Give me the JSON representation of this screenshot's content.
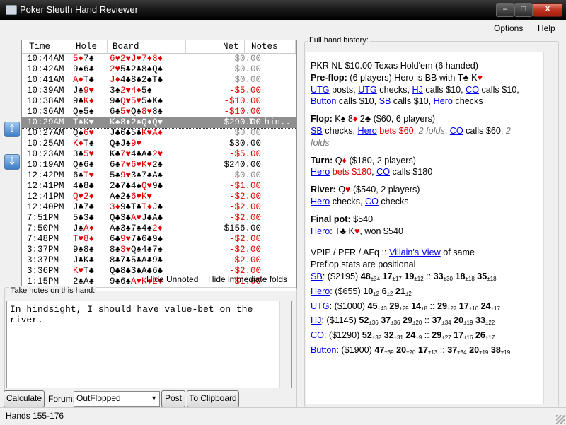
{
  "window": {
    "title": "Poker Sleuth Hand Reviewer",
    "minimize_label": "–",
    "maximize_label": "□",
    "close_label": "X"
  },
  "menu": {
    "options": "Options",
    "help": "Help"
  },
  "hand_list": {
    "columns": {
      "time": "Time",
      "hole": "Hole",
      "board": "Board",
      "net": "Net",
      "notes": "Notes"
    },
    "rows": [
      {
        "time": "10:44AM",
        "hole": [
          [
            "5♦",
            "red"
          ],
          [
            "7♣",
            "black"
          ]
        ],
        "board": [
          [
            "6♥",
            "red"
          ],
          [
            "2♥",
            "red"
          ],
          [
            "J♥",
            "red"
          ],
          [
            "7♦",
            "red"
          ],
          [
            "8♦",
            "red"
          ]
        ],
        "net": "$0.00",
        "net_type": "zero",
        "notes": ""
      },
      {
        "time": "10:42AM",
        "hole": [
          [
            "9♠",
            "black"
          ],
          [
            "6♣",
            "black"
          ]
        ],
        "board": [
          [
            "2♥",
            "red"
          ],
          [
            "5♣",
            "black"
          ],
          [
            "2♣",
            "black"
          ],
          [
            "8♠",
            "black"
          ],
          [
            "Q♠",
            "black"
          ]
        ],
        "net": "$0.00",
        "net_type": "zero",
        "notes": ""
      },
      {
        "time": "10:41AM",
        "hole": [
          [
            "A♦",
            "red"
          ],
          [
            "T♣",
            "black"
          ]
        ],
        "board": [
          [
            "J♦",
            "red"
          ],
          [
            "4♣",
            "black"
          ],
          [
            "8♣",
            "black"
          ],
          [
            "2♠",
            "black"
          ],
          [
            "T♣",
            "black"
          ]
        ],
        "net": "$0.00",
        "net_type": "zero",
        "notes": ""
      },
      {
        "time": "10:39AM",
        "hole": [
          [
            "J♣",
            "black"
          ],
          [
            "9♥",
            "red"
          ]
        ],
        "board": [
          [
            "3♠",
            "black"
          ],
          [
            "2♥",
            "red"
          ],
          [
            "4♦",
            "red"
          ],
          [
            "5♠",
            "black"
          ]
        ],
        "net": "-$5.00",
        "net_type": "neg",
        "notes": ""
      },
      {
        "time": "10:38AM",
        "hole": [
          [
            "9♣",
            "black"
          ],
          [
            "K♦",
            "red"
          ]
        ],
        "board": [
          [
            "9♣",
            "black"
          ],
          [
            "Q♥",
            "red"
          ],
          [
            "5♥",
            "red"
          ],
          [
            "5♠",
            "black"
          ],
          [
            "K♠",
            "black"
          ]
        ],
        "net": "-$10.00",
        "net_type": "neg",
        "notes": ""
      },
      {
        "time": "10:36AM",
        "hole": [
          [
            "Q♠",
            "black"
          ],
          [
            "5♠",
            "black"
          ]
        ],
        "board": [
          [
            "6♣",
            "black"
          ],
          [
            "5♥",
            "red"
          ],
          [
            "Q♣",
            "black"
          ],
          [
            "8♥",
            "red"
          ],
          [
            "8♣",
            "black"
          ]
        ],
        "net": "-$10.00",
        "net_type": "neg",
        "notes": ""
      },
      {
        "time": "10:29AM",
        "hole": [
          [
            "T♣",
            "black"
          ],
          [
            "K♥",
            "red"
          ]
        ],
        "board": [
          [
            "K♠",
            "black"
          ],
          [
            "8♦",
            "red"
          ],
          [
            "2♣",
            "black"
          ],
          [
            "Q♦",
            "red"
          ],
          [
            "Q♥",
            "red"
          ]
        ],
        "net": "$290.00",
        "net_type": "pos",
        "notes": "In hin..",
        "selected": true
      },
      {
        "time": "10:27AM",
        "hole": [
          [
            "Q♠",
            "black"
          ],
          [
            "6♥",
            "red"
          ]
        ],
        "board": [
          [
            "J♣",
            "black"
          ],
          [
            "6♣",
            "black"
          ],
          [
            "5♣",
            "black"
          ],
          [
            "K♥",
            "red"
          ],
          [
            "A♦",
            "red"
          ]
        ],
        "net": "$0.00",
        "net_type": "zero",
        "notes": ""
      },
      {
        "time": "10:25AM",
        "hole": [
          [
            "K♦",
            "red"
          ],
          [
            "T♣",
            "black"
          ]
        ],
        "board": [
          [
            "Q♣",
            "black"
          ],
          [
            "J♣",
            "black"
          ],
          [
            "9♥",
            "red"
          ]
        ],
        "net": "$30.00",
        "net_type": "pos",
        "notes": ""
      },
      {
        "time": "10:23AM",
        "hole": [
          [
            "3♣",
            "black"
          ],
          [
            "5♥",
            "red"
          ]
        ],
        "board": [
          [
            "K♣",
            "black"
          ],
          [
            "7♥",
            "red"
          ],
          [
            "4♣",
            "black"
          ],
          [
            "A♣",
            "black"
          ],
          [
            "2♥",
            "red"
          ]
        ],
        "net": "-$5.00",
        "net_type": "neg",
        "notes": ""
      },
      {
        "time": "10:19AM",
        "hole": [
          [
            "Q♣",
            "black"
          ],
          [
            "6♣",
            "black"
          ]
        ],
        "board": [
          [
            "6♣",
            "black"
          ],
          [
            "7♥",
            "red"
          ],
          [
            "6♥",
            "red"
          ],
          [
            "K♥",
            "red"
          ],
          [
            "2♣",
            "black"
          ]
        ],
        "net": "$240.00",
        "net_type": "pos",
        "notes": ""
      },
      {
        "time": "12:42PM",
        "hole": [
          [
            "6♣",
            "black"
          ],
          [
            "T♥",
            "red"
          ]
        ],
        "board": [
          [
            "5♣",
            "black"
          ],
          [
            "9♥",
            "red"
          ],
          [
            "3♣",
            "black"
          ],
          [
            "7♣",
            "black"
          ],
          [
            "A♣",
            "black"
          ]
        ],
        "net": "$0.00",
        "net_type": "zero",
        "notes": ""
      },
      {
        "time": "12:41PM",
        "hole": [
          [
            "4♣",
            "black"
          ],
          [
            "8♣",
            "black"
          ]
        ],
        "board": [
          [
            "2♣",
            "black"
          ],
          [
            "7♣",
            "black"
          ],
          [
            "4♠",
            "black"
          ],
          [
            "Q♥",
            "red"
          ],
          [
            "9♣",
            "black"
          ]
        ],
        "net": "-$1.00",
        "net_type": "neg",
        "notes": ""
      },
      {
        "time": "12:41PM",
        "hole": [
          [
            "Q♥",
            "red"
          ],
          [
            "2♦",
            "red"
          ]
        ],
        "board": [
          [
            "A♠",
            "black"
          ],
          [
            "2♣",
            "black"
          ],
          [
            "6♥",
            "red"
          ],
          [
            "K♥",
            "red"
          ]
        ],
        "net": "-$2.00",
        "net_type": "neg",
        "notes": ""
      },
      {
        "time": "12:40PM",
        "hole": [
          [
            "J♣",
            "black"
          ],
          [
            "7♣",
            "black"
          ]
        ],
        "board": [
          [
            "3♦",
            "red"
          ],
          [
            "9♣",
            "black"
          ],
          [
            "T♣",
            "black"
          ],
          [
            "T♦",
            "red"
          ],
          [
            "J♣",
            "black"
          ]
        ],
        "net": "-$2.00",
        "net_type": "neg",
        "notes": ""
      },
      {
        "time": "7:51PM",
        "hole": [
          [
            "5♣",
            "black"
          ],
          [
            "3♣",
            "black"
          ]
        ],
        "board": [
          [
            "Q♣",
            "black"
          ],
          [
            "3♣",
            "black"
          ],
          [
            "A♥",
            "red"
          ],
          [
            "J♣",
            "black"
          ],
          [
            "A♣",
            "black"
          ]
        ],
        "net": "-$2.00",
        "net_type": "neg",
        "notes": ""
      },
      {
        "time": "7:50PM",
        "hole": [
          [
            "J♣",
            "black"
          ],
          [
            "A♦",
            "red"
          ]
        ],
        "board": [
          [
            "A♣",
            "black"
          ],
          [
            "3♣",
            "black"
          ],
          [
            "7♣",
            "black"
          ],
          [
            "4♠",
            "black"
          ],
          [
            "2♦",
            "red"
          ]
        ],
        "net": "$156.00",
        "net_type": "pos",
        "notes": ""
      },
      {
        "time": "7:48PM",
        "hole": [
          [
            "T♥",
            "red"
          ],
          [
            "8♦",
            "red"
          ]
        ],
        "board": [
          [
            "6♣",
            "black"
          ],
          [
            "9♥",
            "red"
          ],
          [
            "7♣",
            "black"
          ],
          [
            "6♣",
            "black"
          ],
          [
            "9♠",
            "black"
          ]
        ],
        "net": "-$2.00",
        "net_type": "neg",
        "notes": ""
      },
      {
        "time": "3:37PM",
        "hole": [
          [
            "9♣",
            "black"
          ],
          [
            "8♣",
            "black"
          ]
        ],
        "board": [
          [
            "8♣",
            "black"
          ],
          [
            "3♥",
            "red"
          ],
          [
            "Q♣",
            "black"
          ],
          [
            "4♣",
            "black"
          ],
          [
            "7♠",
            "black"
          ]
        ],
        "net": "-$2.00",
        "net_type": "neg",
        "notes": ""
      },
      {
        "time": "3:37PM",
        "hole": [
          [
            "J♣",
            "black"
          ],
          [
            "K♣",
            "black"
          ]
        ],
        "board": [
          [
            "8♣",
            "black"
          ],
          [
            "7♣",
            "black"
          ],
          [
            "5♣",
            "black"
          ],
          [
            "A♣",
            "black"
          ],
          [
            "9♣",
            "black"
          ]
        ],
        "net": "-$2.00",
        "net_type": "neg",
        "notes": ""
      },
      {
        "time": "3:36PM",
        "hole": [
          [
            "K♥",
            "red"
          ],
          [
            "T♣",
            "black"
          ]
        ],
        "board": [
          [
            "Q♣",
            "black"
          ],
          [
            "8♣",
            "black"
          ],
          [
            "3♣",
            "black"
          ],
          [
            "A♣",
            "black"
          ],
          [
            "6♣",
            "black"
          ]
        ],
        "net": "-$2.00",
        "net_type": "neg",
        "notes": ""
      },
      {
        "time": "1:15PM",
        "hole": [
          [
            "2♣",
            "black"
          ],
          [
            "A♣",
            "black"
          ]
        ],
        "board": [
          [
            "9♣",
            "black"
          ],
          [
            "6♣",
            "black"
          ],
          [
            "A♥",
            "red"
          ],
          [
            "K♦",
            "red"
          ],
          [
            "2♥",
            "red"
          ]
        ],
        "net": "-$1.00",
        "net_type": "neg",
        "notes": ""
      }
    ]
  },
  "filters": {
    "hide_unnoted": "Hide Unnoted",
    "hide_immediate_folds": "Hide immediate folds"
  },
  "notes": {
    "label": "Take notes on this hand:",
    "text": "In hindsight, I should have value-bet on the\nriver."
  },
  "actions": {
    "calculate": "Calculate",
    "forum_label": "Forum:",
    "forum_value": "OutFlopped",
    "post": "Post",
    "to_clipboard": "To Clipboard"
  },
  "history": {
    "label": "Full hand history:",
    "game": "PKR NL $10.00 Texas Hold'em (6 handed)",
    "preflop_hdr": "Pre-flop:",
    "preflop_desc": " (6 players) Hero is BB with T♣ K",
    "preflop_heart": "♥",
    "utg": "UTG",
    "posts": " posts, ",
    "checks": " checks, ",
    "hj": "HJ",
    "calls10": " calls $10, ",
    "co": "CO",
    "button": "Button",
    "sb": "SB",
    "hero": "Hero",
    "checks_end": " checks",
    "flop_hdr": "Flop:",
    "flop_cards_k": " K♠ 8",
    "flop_diamond": "♦",
    "flop_cards_2": " 2♣",
    "flop_pot": " ($60, 6 players)",
    "sb_checks": " checks, ",
    "hero_bets60": " bets $60",
    "comma": ", ",
    "two_folds": "2 folds",
    "co_calls60": " calls $60, ",
    "two": "2",
    "folds": "folds",
    "turn_hdr": "Turn:",
    "turn_card": " Q",
    "turn_diamond": "♦",
    "turn_pot": " ($180, 2 players)",
    "hero_bets180": " bets $180",
    "co_calls180": " calls $180",
    "river_hdr": "River:",
    "river_card": " Q",
    "river_heart": "♥",
    "river_pot": " ($540, 2 players)",
    "hero_checks": " checks, ",
    "co_checks": " checks",
    "final_hdr": "Final pot:",
    "final_amt": " $540",
    "hero_won": ": T♣ K",
    "hero_won_heart": "♥",
    "hero_won_amt": ", won $540",
    "stats_line1a": "VPIP / PFR / AFq :: ",
    "villains_view": "Villain's View",
    "stats_line1b": " of same",
    "stats_line2": "Preflop stats are positional",
    "stats": [
      {
        "pos": "SB",
        "rest": ": ($2195) ",
        "v": [
          "48",
          "±34",
          "17",
          "±17",
          "19",
          "±12"
        ],
        "sep": " :: ",
        "w": [
          "33",
          "±30",
          "18",
          "±18",
          "35",
          "±18"
        ]
      },
      {
        "pos": "Hero",
        "rest": ": ($655) ",
        "v": [
          "10",
          "±2",
          "6",
          "±2",
          "21",
          "±2"
        ],
        "sep": "",
        "w": []
      },
      {
        "pos": "UTG",
        "rest": ": ($1000) ",
        "v": [
          "45",
          "±43",
          "29",
          "±29",
          "14",
          "±8"
        ],
        "sep": " :: ",
        "w": [
          "29",
          "±27",
          "17",
          "±16",
          "24",
          "±17"
        ]
      },
      {
        "pos": "HJ",
        "rest": ": ($1145) ",
        "v": [
          "52",
          "±36",
          "37",
          "±36",
          "29",
          "±20"
        ],
        "sep": " :: ",
        "w": [
          "37",
          "±34",
          "20",
          "±19",
          "33",
          "±22"
        ]
      },
      {
        "pos": "CO",
        "rest": ": ($1290) ",
        "v": [
          "52",
          "±32",
          "32",
          "±31",
          "24",
          "±9"
        ],
        "sep": " :: ",
        "w": [
          "29",
          "±27",
          "17",
          "±16",
          "26",
          "±17"
        ]
      },
      {
        "pos": "Button",
        "rest": ": ($1900) ",
        "v": [
          "47",
          "±39",
          "20",
          "±20",
          "17",
          "±13"
        ],
        "sep": " :: ",
        "w": [
          "37",
          "±34",
          "20",
          "±19",
          "38",
          "±19"
        ]
      }
    ]
  },
  "status": {
    "text": "Hands 155-176"
  },
  "colors": {
    "red_suit": "#e00000",
    "link": "#0000ee",
    "selection": "#8f8f8f"
  }
}
